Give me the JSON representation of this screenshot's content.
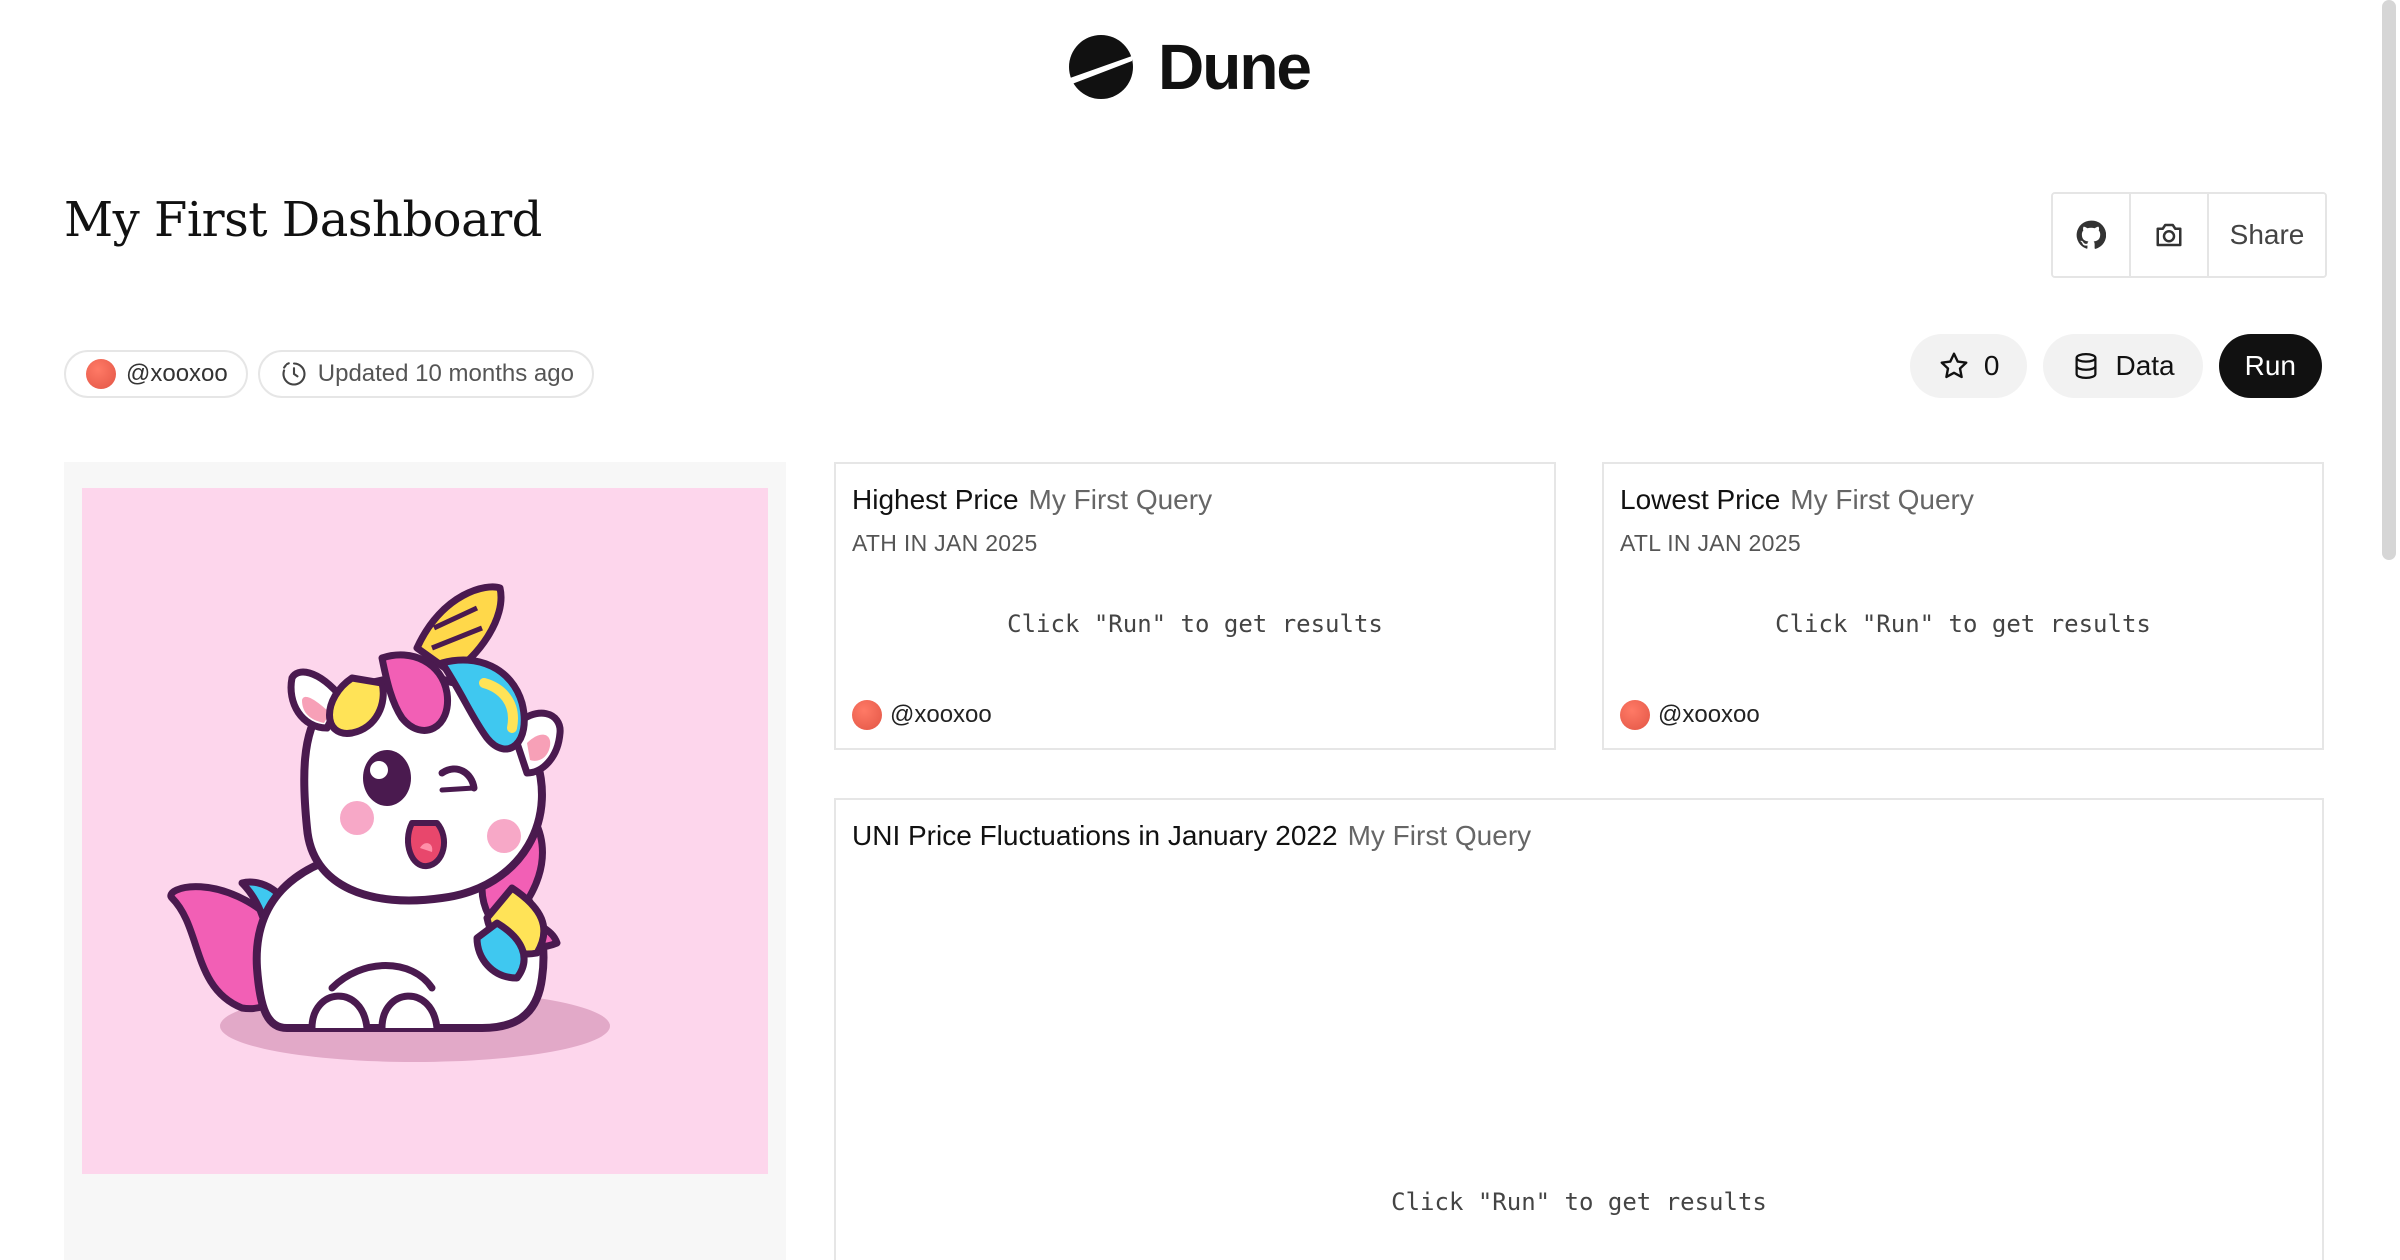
{
  "header": {
    "brand": "Dune"
  },
  "dashboard": {
    "title": "My First Dashboard",
    "share_label": "Share",
    "author": "@xooxoo",
    "updated": "Updated 10 months ago",
    "star_count": "0",
    "data_label": "Data",
    "run_label": "Run"
  },
  "widgets": [
    {
      "title": "Highest Price",
      "query": "My First Query",
      "subtitle": "ATH IN JAN 2025",
      "placeholder": "Click \"Run\" to get results",
      "author": "@xooxoo"
    },
    {
      "title": "Lowest Price",
      "query": "My First Query",
      "subtitle": "ATL IN JAN 2025",
      "placeholder": "Click \"Run\" to get results",
      "author": "@xooxoo"
    },
    {
      "title": "UNI Price Fluctuations in January 2022",
      "query": "My First Query",
      "placeholder": "Click \"Run\" to get results"
    }
  ],
  "icons": {
    "logo": "dune-logo-icon",
    "github": "github-icon",
    "screenshot": "camera-icon",
    "updated": "clock-icon",
    "star": "star-icon",
    "data": "database-icon"
  },
  "colors": {
    "accent": "#111111",
    "image_background": "#fdd6ec",
    "avatar": "#e85a48"
  }
}
